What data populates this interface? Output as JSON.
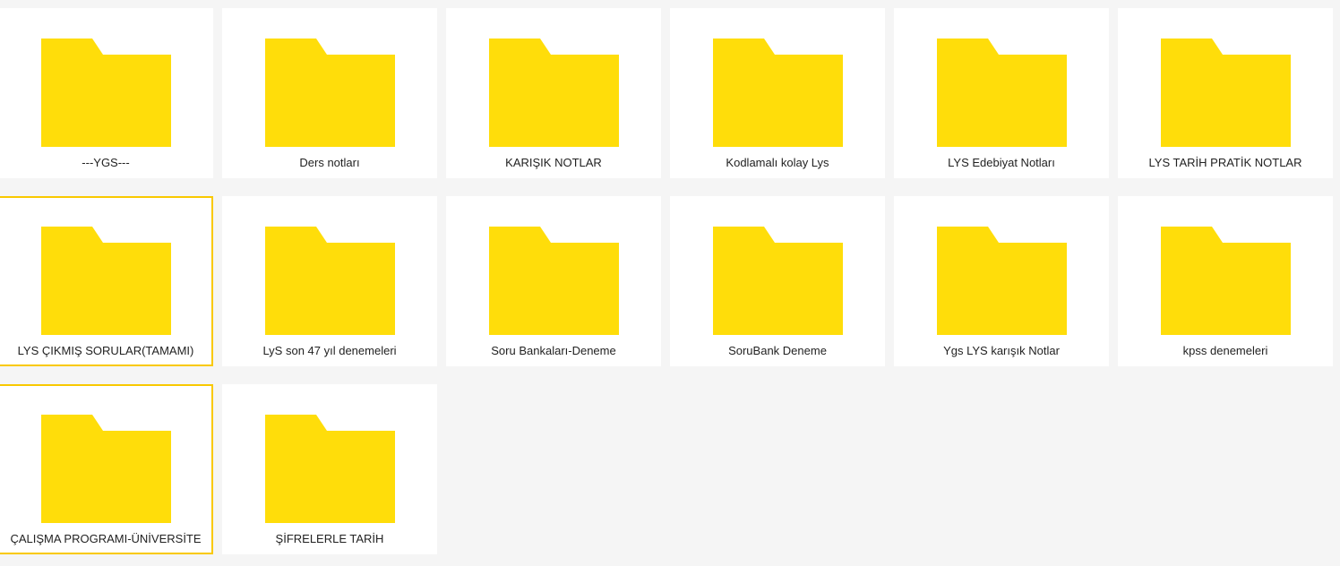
{
  "colors": {
    "background": "#f5f5f5",
    "tile": "#ffffff",
    "folder": "#ffdd0a",
    "selected_border": "#f9c900",
    "text": "#222222"
  },
  "folders": [
    {
      "name": "---YGS---",
      "icon": "folder-icon",
      "selected": false
    },
    {
      "name": "Ders notları",
      "icon": "folder-icon",
      "selected": false
    },
    {
      "name": "KARIŞIK NOTLAR",
      "icon": "folder-icon",
      "selected": false
    },
    {
      "name": "Kodlamalı kolay Lys",
      "icon": "folder-icon",
      "selected": false
    },
    {
      "name": "LYS Edebiyat Notları",
      "icon": "folder-icon",
      "selected": false
    },
    {
      "name": "LYS TARİH PRATİK NOTLAR",
      "icon": "folder-icon",
      "selected": false
    },
    {
      "name": "LYS ÇIKMIŞ SORULAR(TAMAMI)",
      "icon": "folder-icon",
      "selected": true
    },
    {
      "name": "LyS son 47 yıl denemeleri",
      "icon": "folder-icon",
      "selected": false
    },
    {
      "name": "Soru Bankaları-Deneme",
      "icon": "folder-icon",
      "selected": false
    },
    {
      "name": "SoruBank Deneme",
      "icon": "folder-icon",
      "selected": false
    },
    {
      "name": "Ygs LYS karışık Notlar",
      "icon": "folder-icon",
      "selected": false
    },
    {
      "name": "kpss denemeleri",
      "icon": "folder-icon",
      "selected": false
    },
    {
      "name": "ÇALIŞMA PROGRAMI-ÜNİVERSİTE",
      "icon": "folder-icon",
      "selected": true
    },
    {
      "name": "ŞİFRELERLE TARİH",
      "icon": "folder-icon",
      "selected": false
    }
  ]
}
